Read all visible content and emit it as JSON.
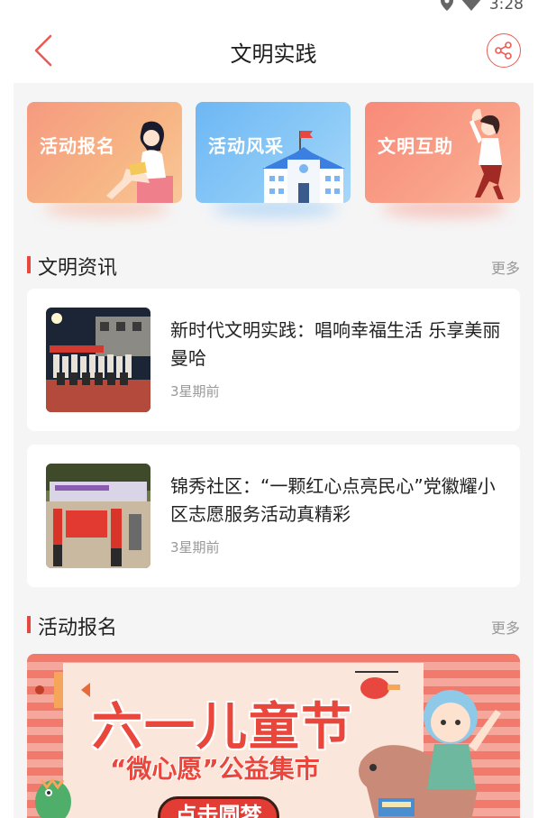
{
  "status_bar": {
    "time": "3:28",
    "icons": [
      "location-icon",
      "wifi-icon"
    ]
  },
  "header": {
    "title": "文明实践",
    "back_icon": "chevron-left-icon",
    "share_icon": "share-icon"
  },
  "colors": {
    "accent": "#e8473f",
    "background": "#f5f5f6",
    "muted_text": "#999999"
  },
  "tiles": [
    {
      "label": "活动报名",
      "icon": "reading-girl-illustration",
      "color": "#f59a80"
    },
    {
      "label": "活动风采",
      "icon": "school-building-illustration",
      "color": "#6db7f4"
    },
    {
      "label": "文明互助",
      "icon": "waving-woman-illustration",
      "color": "#f88a78"
    }
  ],
  "news_section": {
    "title": "文明资讯",
    "more": "更多",
    "items": [
      {
        "title": "新时代文明实践：唱响幸福生活 乐享美丽曼哈",
        "time": "3星期前"
      },
      {
        "title": "锦秀社区：“一颗红心点亮民心”党徽耀小区志愿服务活动真精彩",
        "time": "3星期前"
      }
    ]
  },
  "activity_section": {
    "title": "活动报名",
    "more": "更多",
    "banner": {
      "title": "六一儿童节",
      "subtitle": "“微心愿”公益集市",
      "button": "点击圆梦"
    }
  }
}
